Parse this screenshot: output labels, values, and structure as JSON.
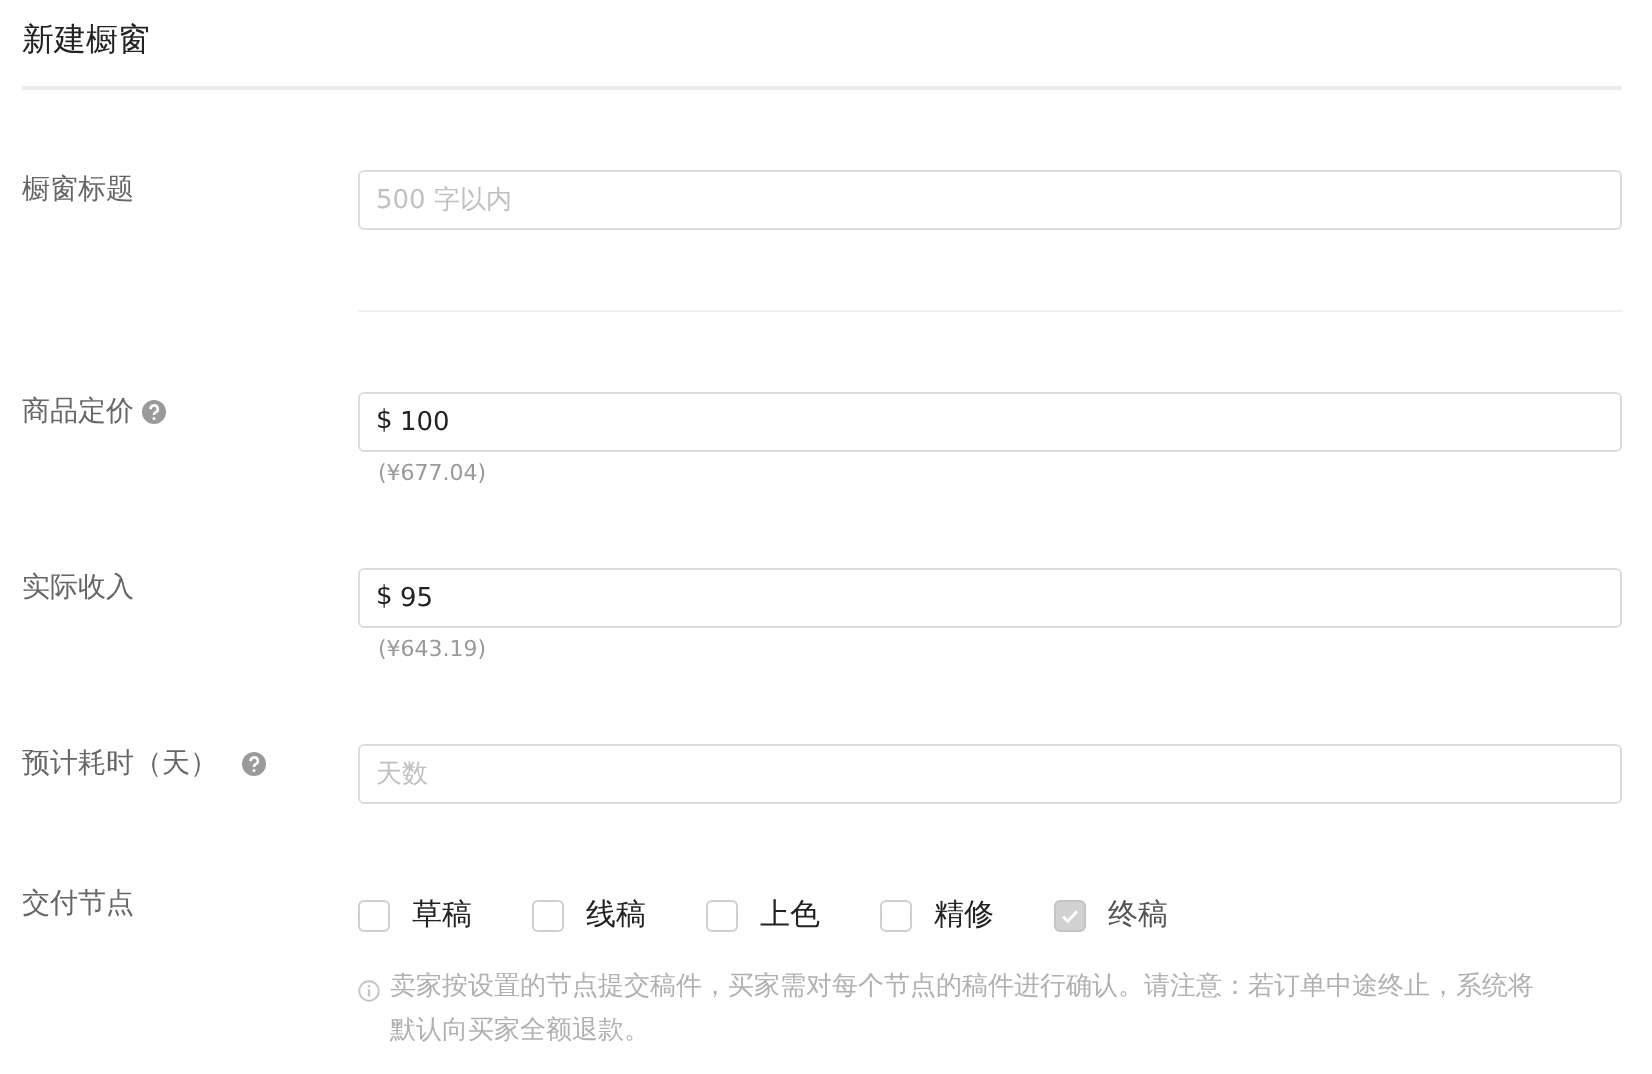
{
  "page_title": "新建橱窗",
  "fields": [
    {
      "kind": "text",
      "label": "橱窗标题",
      "help": false,
      "placeholder": "500 字以内",
      "divider_after": true
    },
    {
      "kind": "money",
      "label": "商品定价",
      "help": true,
      "prefix": "$",
      "value": "100",
      "sub": "(¥677.04)"
    },
    {
      "kind": "money",
      "label": "实际收入",
      "help": false,
      "prefix": "$",
      "value": "95",
      "sub": "(¥643.19)"
    },
    {
      "kind": "text",
      "label": "预计耗时（天）",
      "help": true,
      "placeholder": "天数"
    },
    {
      "kind": "checks",
      "label": "交付节点",
      "options": [
        {
          "label": "草稿",
          "checked": false,
          "disabled": false
        },
        {
          "label": "线稿",
          "checked": false,
          "disabled": false
        },
        {
          "label": "上色",
          "checked": false,
          "disabled": false
        },
        {
          "label": "精修",
          "checked": false,
          "disabled": false
        },
        {
          "label": "终稿",
          "checked": true,
          "disabled": true
        }
      ],
      "note": "卖家按设置的节点提交稿件，买家需对每个节点的稿件进行确认。请注意：若订单中途终止，系统将默认向买家全额退款。"
    }
  ]
}
